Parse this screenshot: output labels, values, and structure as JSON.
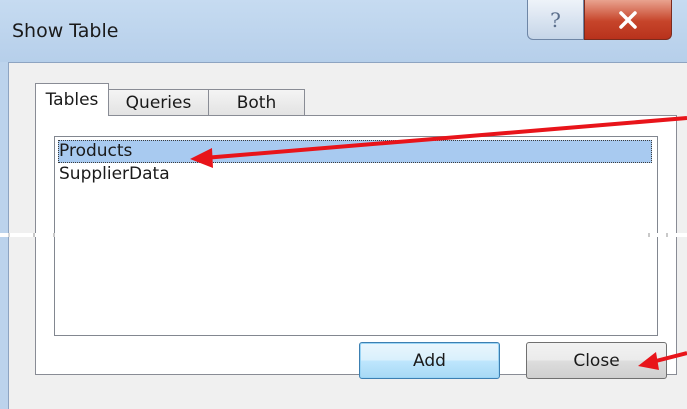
{
  "window": {
    "title": "Show Table",
    "help_glyph": "?",
    "close_glyph": "X"
  },
  "tabs": [
    {
      "label": "Tables",
      "active": true
    },
    {
      "label": "Queries",
      "active": false
    },
    {
      "label": "Both",
      "active": false
    }
  ],
  "list": {
    "items": [
      {
        "label": "Products",
        "selected": true
      },
      {
        "label": "SupplierData",
        "selected": false
      }
    ]
  },
  "buttons": {
    "add_label": "Add",
    "close_label": "Close"
  },
  "colors": {
    "selection": "#a8caf0",
    "annotation_arrow": "#e8141a",
    "titlebar": "#bcd3ec"
  }
}
